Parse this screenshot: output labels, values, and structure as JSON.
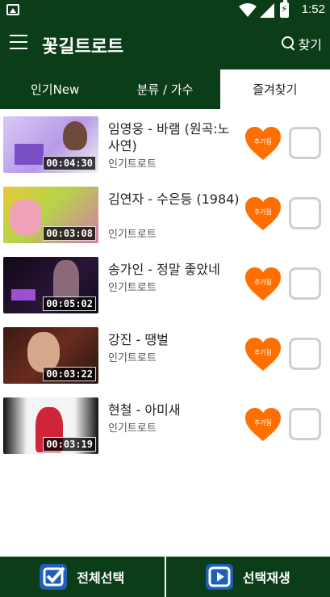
{
  "status_bar": {
    "time": "1:52"
  },
  "app": {
    "title": "꽃길트로트",
    "search_label": "찾기"
  },
  "tabs": [
    {
      "label": "인기New",
      "active": false
    },
    {
      "label": "분류 / 가수",
      "active": false
    },
    {
      "label": "즐겨찾기",
      "active": true
    }
  ],
  "items": [
    {
      "title": "임영웅 - 바램 (원곡:노사연)",
      "category": "인기트로트",
      "duration": "00:04:30",
      "fav_label": "추가됨"
    },
    {
      "title": "김연자 - 수은등 (1984)",
      "category": "인기트로트",
      "duration": "00:03:08",
      "fav_label": "추가됨"
    },
    {
      "title": "송가인 - 정말 좋았네",
      "category": "인기트로트",
      "duration": "00:05:02",
      "fav_label": "추가됨"
    },
    {
      "title": "강진 - 땡벌",
      "category": "인기트로트",
      "duration": "00:03:22",
      "fav_label": "추가됨"
    },
    {
      "title": "현철 - 아미새",
      "category": "인기트로트",
      "duration": "00:03:19",
      "fav_label": "추가됨"
    }
  ],
  "bottom": {
    "select_all": "전체선택",
    "play_selected": "선택재생"
  },
  "colors": {
    "primary": "#0b3d18",
    "heart": "#ff6f00",
    "icon_blue": "#1e5fb8"
  }
}
